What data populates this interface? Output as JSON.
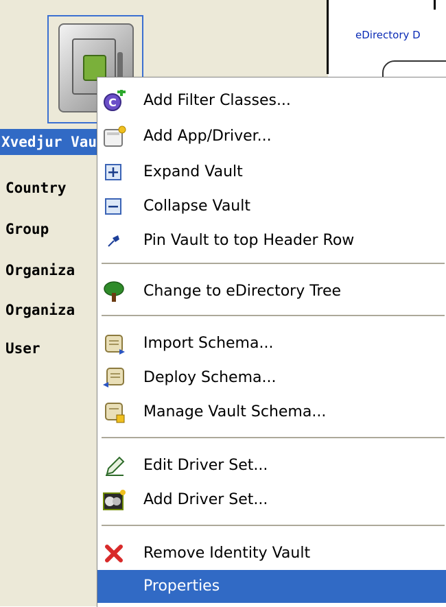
{
  "header": {
    "right_label": "eDirectory D"
  },
  "vault": {
    "label": "Xvedjur Vault",
    "categories": [
      "Country",
      "Group",
      "Organiza",
      "Organiza",
      "User"
    ]
  },
  "context_menu": {
    "items": [
      {
        "label": "Add Filter Classes...",
        "icon": "add-filter-classes-icon"
      },
      {
        "label": "Add App/Driver...",
        "icon": "add-app-driver-icon"
      },
      {
        "label": "Expand Vault",
        "icon": "expand-icon"
      },
      {
        "label": "Collapse Vault",
        "icon": "collapse-icon"
      },
      {
        "label": "Pin Vault to top Header Row",
        "icon": "pin-icon"
      },
      {
        "label": "Change to eDirectory Tree",
        "icon": "tree-icon"
      },
      {
        "label": "Import Schema...",
        "icon": "import-schema-icon"
      },
      {
        "label": "Deploy Schema...",
        "icon": "deploy-schema-icon"
      },
      {
        "label": "Manage Vault Schema...",
        "icon": "manage-schema-icon"
      },
      {
        "label": "Edit Driver Set...",
        "icon": "pencil-icon"
      },
      {
        "label": "Add Driver Set...",
        "icon": "add-driver-set-icon"
      },
      {
        "label": "Remove Identity Vault",
        "icon": "remove-icon"
      },
      {
        "label": "Properties",
        "icon": "none"
      }
    ],
    "highlighted_item": "Properties"
  },
  "colors": {
    "selection": "#316ac5",
    "panel": "#ece9d8",
    "link": "#0a2bb5",
    "remove": "#d82a2a"
  }
}
